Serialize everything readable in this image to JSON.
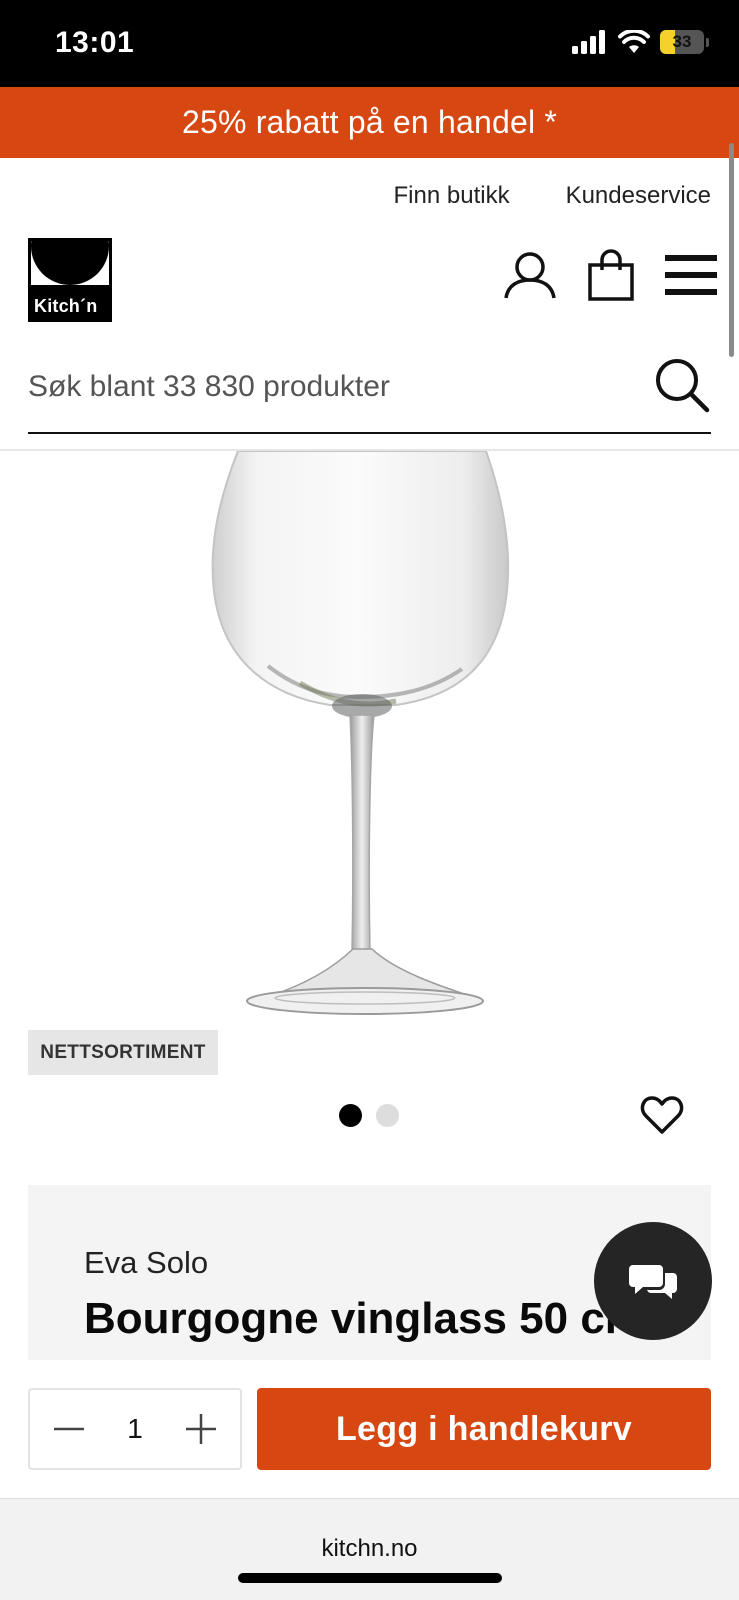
{
  "status_bar": {
    "time": "13:01",
    "battery_level": "33",
    "battery_fraction": 0.33
  },
  "promo": {
    "text": "25% rabatt på en handel *"
  },
  "top_links": {
    "find_store": "Finn butikk",
    "customer_service": "Kundeservice"
  },
  "logo": {
    "text": "Kitch´n"
  },
  "header_icons": [
    "user-icon",
    "shopping-bag-icon",
    "hamburger-menu-icon"
  ],
  "search": {
    "placeholder": "Søk blant 33 830 produkter",
    "value": ""
  },
  "product": {
    "badge": "NETTSORTIMENT",
    "image_count": 2,
    "active_image_index": 0,
    "brand": "Eva Solo",
    "title": "Bourgogne vinglass 50 cl"
  },
  "buy_bar": {
    "quantity": "1",
    "add_to_cart_label": "Legg i handlekurv"
  },
  "browser": {
    "url": "kitchn.no"
  },
  "colors": {
    "accent": "#d64712",
    "card_bg": "#f5f4f5",
    "chat_bg": "#252525",
    "badge_bg": "#e6e6e6"
  }
}
